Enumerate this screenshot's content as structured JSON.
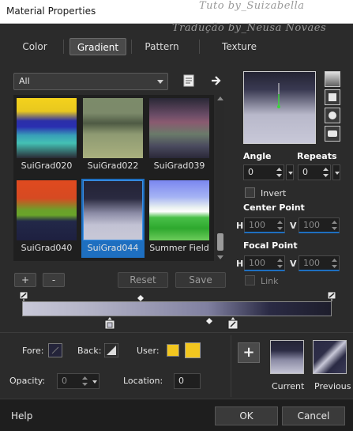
{
  "window": {
    "title": "Material Properties",
    "watermark_line1": "Tuto by_Suizabella",
    "watermark_line2": "Tradução by_Neusa Novaes"
  },
  "tabs": [
    {
      "label": "Color",
      "active": false
    },
    {
      "label": "Gradient",
      "active": true
    },
    {
      "label": "Pattern",
      "active": false
    },
    {
      "label": "Texture",
      "active": false
    }
  ],
  "category_dropdown": {
    "value": "All"
  },
  "gradients": [
    {
      "label": "SuiGrad020",
      "selected": false
    },
    {
      "label": "SuiGrad022",
      "selected": false
    },
    {
      "label": "SuiGrad039",
      "selected": false
    },
    {
      "label": "SuiGrad040",
      "selected": false
    },
    {
      "label": "SuiGrad044",
      "selected": true
    },
    {
      "label": "Summer Field",
      "selected": false
    }
  ],
  "library_buttons": {
    "add": "+",
    "remove": "-",
    "reset": "Reset",
    "save": "Save"
  },
  "settings": {
    "angle_label": "Angle",
    "angle_value": "0",
    "repeats_label": "Repeats",
    "repeats_value": "0",
    "invert_label": "Invert",
    "center_point_label": "Center Point",
    "center_h_label": "H",
    "center_h_value": "100",
    "center_v_label": "V",
    "center_v_value": "100",
    "focal_point_label": "Focal Point",
    "focal_h_label": "H",
    "focal_h_value": "100",
    "focal_v_label": "V",
    "focal_v_value": "100",
    "link_label": "Link"
  },
  "stop_panel": {
    "fore_label": "Fore:",
    "back_label": "Back:",
    "user_label": "User:",
    "opacity_label": "Opacity:",
    "opacity_value": "0",
    "location_label": "Location:",
    "location_value": "0",
    "user_color": "#f2c61f"
  },
  "swatches": {
    "current_label": "Current",
    "previous_label": "Previous",
    "add_button": "+"
  },
  "footer": {
    "help_label": "Help",
    "ok_label": "OK",
    "cancel_label": "Cancel"
  },
  "colors": {
    "accent_blue": "#1e6fc0",
    "background": "#2b2b2b",
    "footer_bg": "#1e1e1e"
  }
}
